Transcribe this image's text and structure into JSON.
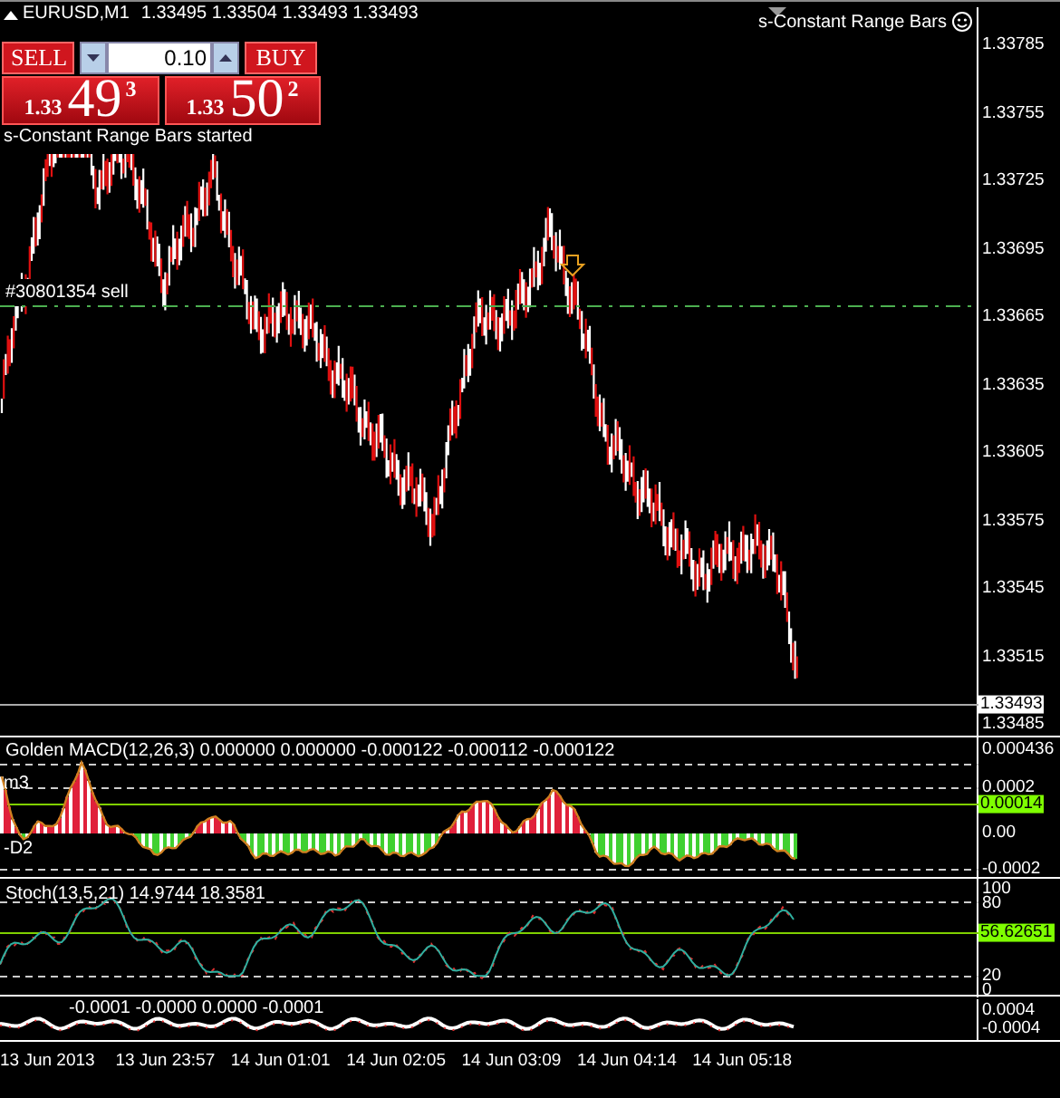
{
  "header": {
    "symbol": "EURUSD,M1",
    "quotes": "1.33495 1.33504 1.33493 1.33493"
  },
  "trade_panel": {
    "sell_label": "SELL",
    "buy_label": "BUY",
    "lot": "0.10",
    "sell_price": {
      "prefix": "1.33",
      "big": "49",
      "small": "3"
    },
    "buy_price": {
      "prefix": "1.33",
      "big": "50",
      "small": "2"
    }
  },
  "main_chart": {
    "status_text": "s-Constant Range Bars started",
    "expert_label": "s-Constant Range Bars",
    "order_label": "#30801354 sell",
    "price_axis": [
      "1.33785",
      "1.33755",
      "1.33725",
      "1.33695",
      "1.33665",
      "1.33635",
      "1.33605",
      "1.33575",
      "1.33545",
      "1.33515",
      "1.33485"
    ],
    "current_price": "1.33493"
  },
  "macd_panel": {
    "title": "Golden MACD(12,26,3) 0.000000 0.000000 -0.000122 -0.000112 -0.000122",
    "labels": [
      "m3",
      "-D2"
    ],
    "axis": [
      {
        "label": "0.000436",
        "kind": "tick"
      },
      {
        "label": "0.0002",
        "kind": "tick"
      },
      {
        "label": "0.00014",
        "kind": "level"
      },
      {
        "label": "0.00",
        "kind": "tick"
      },
      {
        "label": "-0.0002",
        "kind": "tick"
      }
    ]
  },
  "stoch_panel": {
    "title": "Stoch(13,5,21) 14.9744 18.3581",
    "axis": [
      {
        "label": "100",
        "kind": "tick"
      },
      {
        "label": "80",
        "kind": "tick"
      },
      {
        "label": "56.62651",
        "kind": "level"
      },
      {
        "label": "20",
        "kind": "tick"
      },
      {
        "label": "0",
        "kind": "tick"
      }
    ]
  },
  "osc_panel": {
    "values": "-0.0001 -0.0000 0.0000 -0.0001",
    "axis": [
      {
        "label": "0.0004",
        "kind": "tick"
      },
      {
        "label": "-0.0004",
        "kind": "tick"
      }
    ]
  },
  "time_axis": [
    "13 Jun 2013",
    "13 Jun 23:57",
    "14 Jun 01:01",
    "14 Jun 02:05",
    "14 Jun 03:09",
    "14 Jun 04:14",
    "14 Jun 05:18"
  ]
}
